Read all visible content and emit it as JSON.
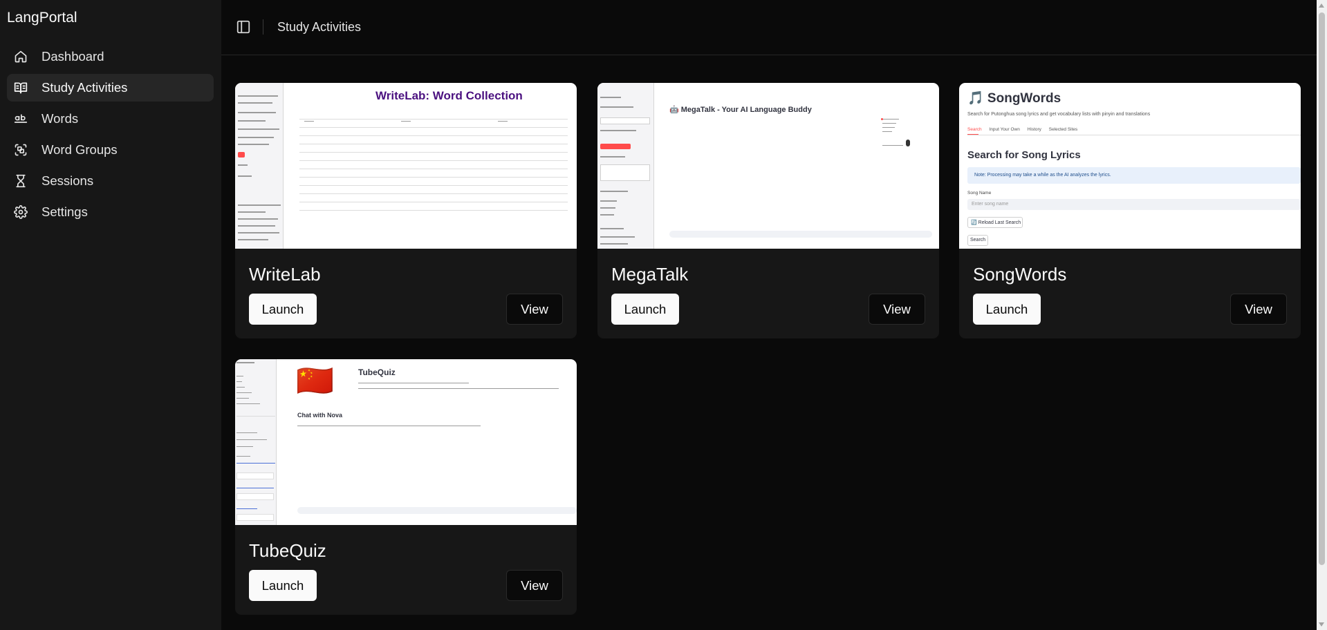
{
  "app": {
    "name": "LangPortal"
  },
  "sidebar": {
    "items": [
      {
        "label": "Dashboard",
        "icon": "home-icon",
        "active": false
      },
      {
        "label": "Study Activities",
        "icon": "book-open-icon",
        "active": true
      },
      {
        "label": "Words",
        "icon": "whole-word-icon",
        "active": false
      },
      {
        "label": "Word Groups",
        "icon": "word-groups-icon",
        "active": false
      },
      {
        "label": "Sessions",
        "icon": "hourglass-icon",
        "active": false
      },
      {
        "label": "Settings",
        "icon": "gear-icon",
        "active": false
      }
    ]
  },
  "header": {
    "title": "Study Activities",
    "toggle_icon": "panel-left-icon"
  },
  "cards": [
    {
      "title": "WriteLab",
      "launch_label": "Launch",
      "view_label": "View",
      "preview": {
        "heading": "WriteLab: Word Collection",
        "heading_color": "#4b1180"
      }
    },
    {
      "title": "MegaTalk",
      "launch_label": "Launch",
      "view_label": "View",
      "preview": {
        "heading": "🤖 MegaTalk - Your AI Language Buddy"
      }
    },
    {
      "title": "SongWords",
      "launch_label": "Launch",
      "view_label": "View",
      "preview": {
        "heading": "🎵 SongWords",
        "description": "Search for Putonghua song lyrics and get vocabulary lists with pinyin and translations",
        "tabs": [
          "Search",
          "Input Your Own",
          "History",
          "Selected Sites"
        ],
        "subheading": "Search for Song Lyrics",
        "note": "Note: Processing may take a while as the AI analyzes the lyrics.",
        "field_label": "Song Name",
        "field_placeholder": "Enter song name",
        "reload_label": "🔄 Reload Last Search",
        "search_label": "Search"
      }
    },
    {
      "title": "TubeQuiz",
      "launch_label": "Launch",
      "view_label": "View",
      "preview": {
        "heading": "TubeQuiz",
        "flag": "🇨🇳",
        "chat_heading": "Chat with Nova"
      }
    }
  ],
  "colors": {
    "sidebar_bg": "#171717",
    "main_bg": "#0a0a0a",
    "card_bg": "#171717",
    "active_item_bg": "#262626",
    "accent_red": "#ff4b4b",
    "songwords_note_bg": "#e8f0fb"
  }
}
